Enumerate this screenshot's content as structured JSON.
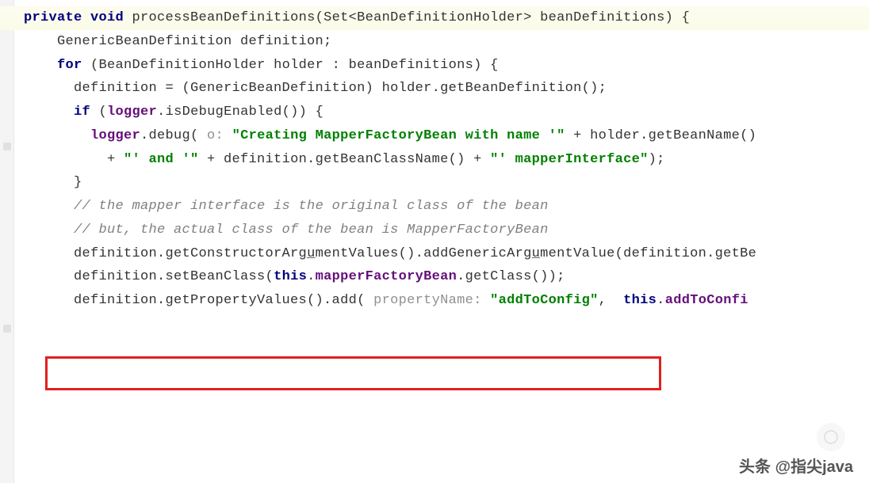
{
  "code": {
    "line1": {
      "kw1": "private void",
      "method": " processBeanDefinitions(Set<BeanDefinitionHolder> beanDefinitions) ",
      "brace": "{"
    },
    "line2": "    GenericBeanDefinition definition;",
    "line3": {
      "indent": "    ",
      "kw": "for",
      "rest": " (BeanDefinitionHolder holder : beanDefinitions) {"
    },
    "line4": "      definition = (GenericBeanDefinition) holder.getBeanDefinition();",
    "line5": "",
    "line6": {
      "indent": "      ",
      "kw": "if",
      "open": " (",
      "logger": "logger",
      "rest": ".isDebugEnabled()) {"
    },
    "line7": {
      "indent": "        ",
      "logger": "logger",
      "dot": ".debug(",
      "hint": " o: ",
      "str1": "\"Creating MapperFactoryBean with name '\"",
      "plus": " + holder.getBeanName()"
    },
    "line8": {
      "indent": "          + ",
      "str1": "\"' and '\"",
      "mid": " + definition.getBeanClassName() + ",
      "str2": "\"' mapperInterface\"",
      "end": ");"
    },
    "line9": "      }",
    "line10": "",
    "line11": {
      "indent": "      ",
      "cmt": "// the mapper interface is the original class of the bean"
    },
    "line12": {
      "indent": "      ",
      "cmt": "// but, the actual class of the bean is MapperFactoryBean"
    },
    "line13": {
      "pre": "      definition.getConstructorArg",
      "u1": "u",
      "mid": "mentValues().addGenericArg",
      "u2": "u",
      "post": "mentValue(definition.getBe"
    },
    "line14": {
      "pre": "      definition.setBeanClass(",
      "kw": "this",
      "dot1": ".",
      "field": "mapperFactoryBean",
      "rest": ".getClass());"
    },
    "line15": "",
    "line16": {
      "pre": "      definition.getPropertyValues().add(",
      "hint": " propertyName: ",
      "str": "\"addToConfig\"",
      "comma": ",  ",
      "kw": "this",
      "dot": ".",
      "field": "addToConfi"
    }
  },
  "watermark": "头条 @指尖java"
}
